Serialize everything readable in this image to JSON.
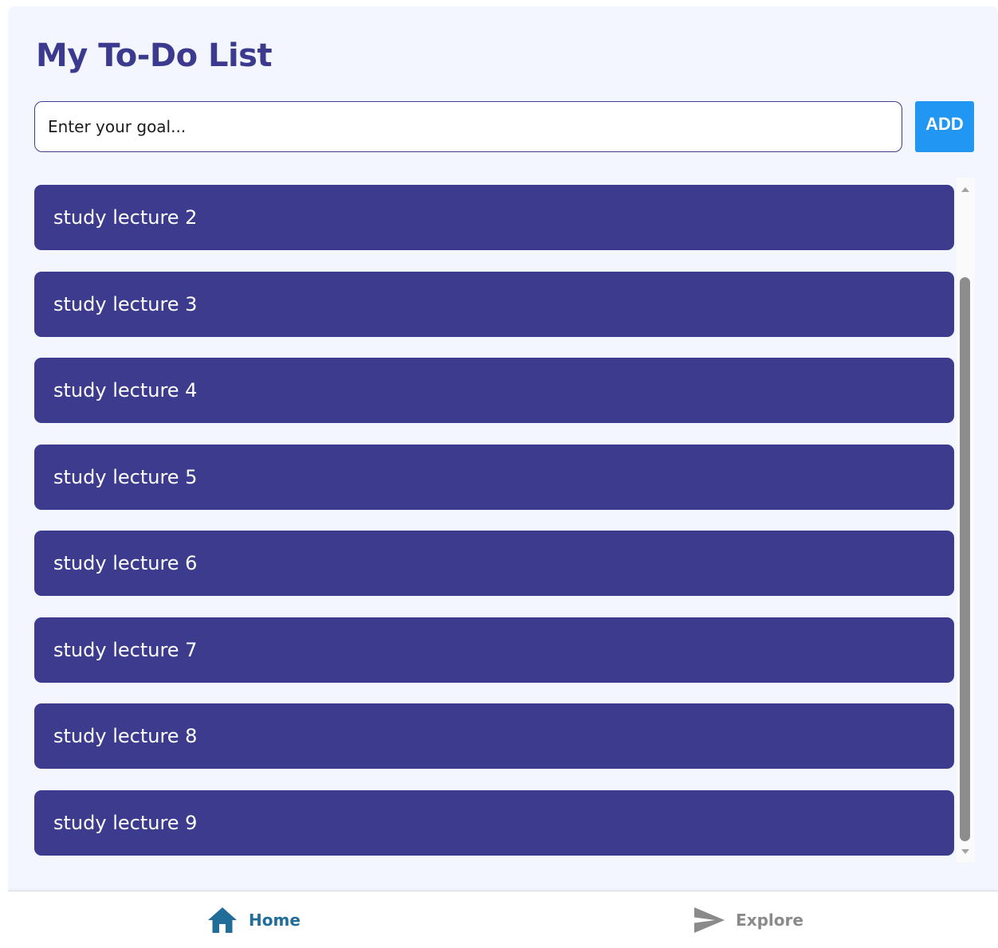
{
  "header": {
    "title": "My To-Do List"
  },
  "goal_input": {
    "placeholder": "Enter your goal...",
    "value": ""
  },
  "add_button": {
    "label": "ADD"
  },
  "goals": [
    "study lecture 2",
    "study lecture 3",
    "study lecture 4",
    "study lecture 5",
    "study lecture 6",
    "study lecture 7",
    "study lecture 8",
    "study lecture 9"
  ],
  "tabs": [
    {
      "label": "Home",
      "icon": "home-icon",
      "active": true
    },
    {
      "label": "Explore",
      "icon": "send-icon",
      "active": false
    }
  ],
  "colors": {
    "page_background": "#f3f6fe",
    "title": "#3b3a8f",
    "goal_item": "#3d3b8e",
    "add_button": "#2196f3",
    "tab_active": "#1f6d98",
    "tab_inactive": "#8a8a8a"
  }
}
